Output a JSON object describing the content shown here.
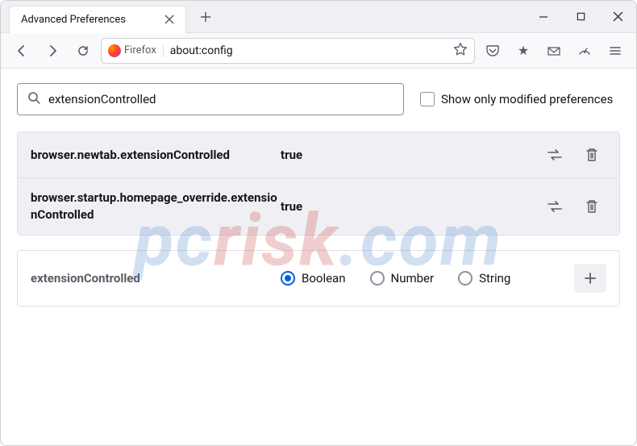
{
  "tab": {
    "title": "Advanced Preferences"
  },
  "addressbar": {
    "identity_label": "Firefox",
    "url": "about:config"
  },
  "search": {
    "value": "extensionControlled",
    "checkbox_label": "Show only modified preferences"
  },
  "preferences": [
    {
      "name": "browser.newtab.extensionControlled",
      "value": "true"
    },
    {
      "name": "browser.startup.homepage_override.extensionControlled",
      "value": "true"
    }
  ],
  "new_pref": {
    "name": "extensionControlled",
    "types": [
      "Boolean",
      "Number",
      "String"
    ],
    "selected_index": 0
  },
  "watermark": {
    "text1": "pc",
    "text2": "risk",
    "text3": ".com"
  }
}
